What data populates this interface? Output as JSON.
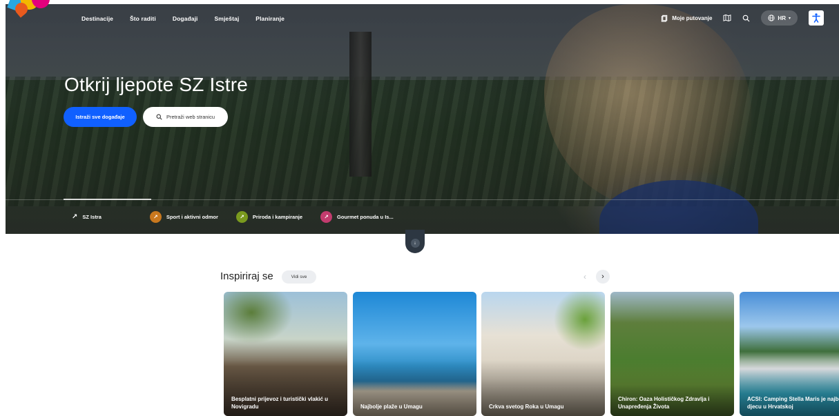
{
  "nav": {
    "items": [
      "Destinacije",
      "Što raditi",
      "Događaji",
      "Smještaj",
      "Planiranje"
    ]
  },
  "tools": {
    "trip_label": "Moje putovanje",
    "lang": "HR"
  },
  "hero": {
    "title": "Otkrij ljepote SZ Istre",
    "primary_button": "Istraži sve događaje",
    "search_button": "Pretraži web stranicu"
  },
  "tabs": [
    {
      "label": "SZ Istra",
      "color": ""
    },
    {
      "label": "Sport i aktivni odmor",
      "color": "#c8781e"
    },
    {
      "label": "Priroda i kampiranje",
      "color": "#7a9a1e"
    },
    {
      "label": "Gourmet ponuda u Is...",
      "color": "#c23c6e"
    }
  ],
  "inspire": {
    "title": "Inspiriraj se",
    "see_all": "Vidi sve",
    "cards": [
      {
        "title": "Besplatni prijevoz i turistički vlakić u Novigradu"
      },
      {
        "title": "Najbolje plaže u Umagu"
      },
      {
        "title": "Crkva svetog Roka u Umagu"
      },
      {
        "title": "Chiron: Oaza Holističkog Zdravlja i Unapređenja Života"
      },
      {
        "title": "ACSI: Camping Stella Maris je najbolji kamp za djecu u Hrvatskoj"
      }
    ]
  },
  "colors": {
    "primary": "#1060ff"
  }
}
